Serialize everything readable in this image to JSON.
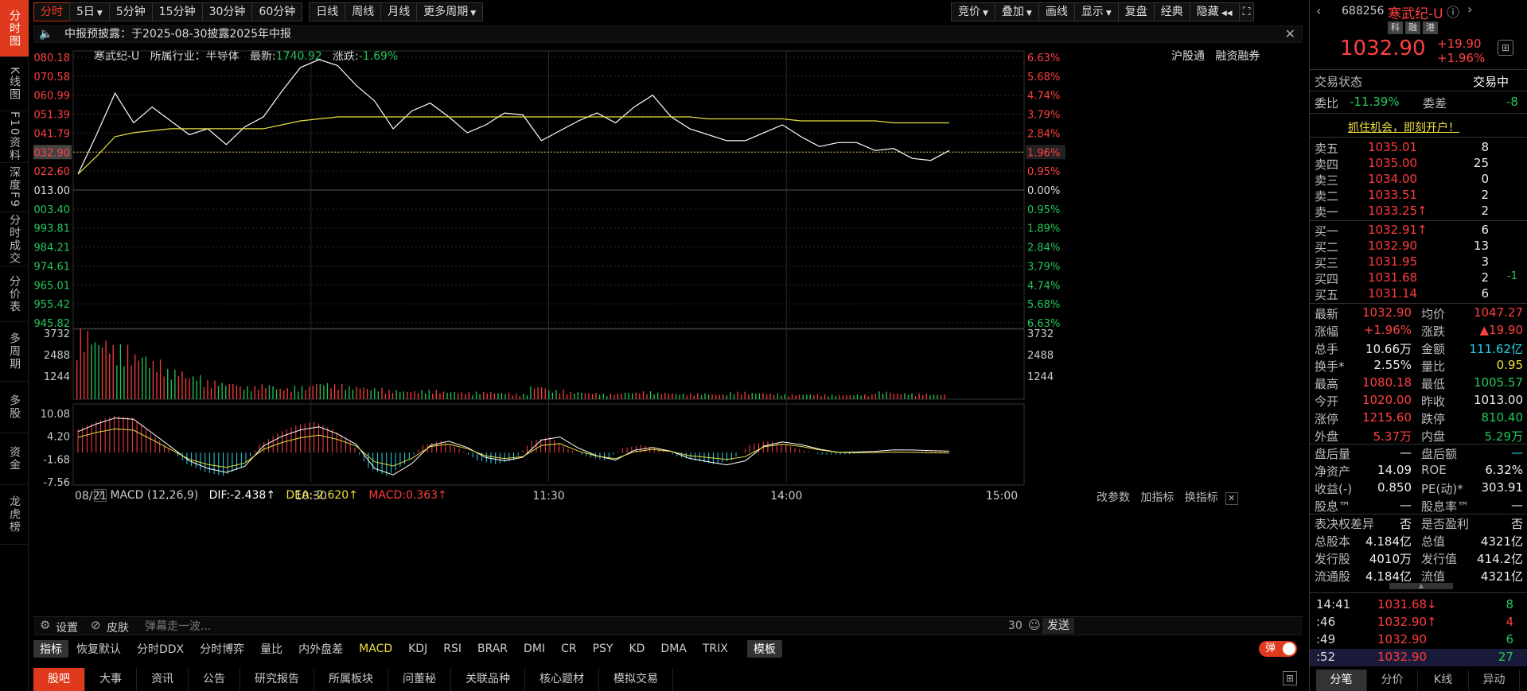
{
  "leftnav": {
    "items": [
      "分时图",
      "K线图",
      "F10资料",
      "深度F9",
      "分时成交",
      "分价表",
      "多周期",
      "多股",
      "资金",
      "龙虎榜"
    ]
  },
  "toolbar": {
    "periods": [
      "分时",
      "5日",
      "5分钟",
      "15分钟",
      "30分钟",
      "60分钟",
      "日线",
      "周线",
      "月线",
      "更多周期"
    ],
    "right": [
      "竞价",
      "叠加",
      "画线",
      "显示",
      "复盘",
      "经典",
      "隐藏"
    ]
  },
  "notice": {
    "text": "中报预披露：于2025-08-30披露2025年中报"
  },
  "info": {
    "name": "寒武纪-U",
    "industry_label": "所属行业：",
    "industry": "半导体",
    "latest_label": "最新:",
    "latest": "1740.92",
    "change_label": "涨跌:",
    "change": "-1.69%",
    "right_links": [
      "沪股通",
      "融资融券"
    ]
  },
  "price_axis": {
    "left": [
      "1080.18",
      "1070.58",
      "1060.99",
      "1051.39",
      "1041.79",
      "1032.90",
      "1022.60",
      "1013.00",
      "1003.40",
      "993.81",
      "984.21",
      "974.61",
      "965.01",
      "955.42",
      "945.82"
    ],
    "right": [
      "6.63%",
      "5.68%",
      "4.74%",
      "3.79%",
      "2.84%",
      "1.96%",
      "0.95%",
      "0.00%",
      "0.95%",
      "1.89%",
      "2.84%",
      "3.79%",
      "4.74%",
      "5.68%",
      "6.63%"
    ]
  },
  "volume_axis": {
    "left": [
      "3732",
      "2488",
      "1244"
    ],
    "right": [
      "3732",
      "2488",
      "1244"
    ]
  },
  "macd_axis": [
    "10.08",
    "4.20",
    "-1.68",
    "-7.56"
  ],
  "time_axis": [
    "08/21",
    "10:30",
    "11:30",
    "14:00",
    "15:00"
  ],
  "macd": {
    "name": "MACD (12,26,9)",
    "dif": "DIF:-2.438↑",
    "dea": "DEA:-2.620↑",
    "macd": "MACD:0.363↑",
    "tools": [
      "改参数",
      "加指标",
      "换指标"
    ]
  },
  "danmu": {
    "settings": "设置",
    "skin": "皮肤",
    "placeholder": "弹幕走一波...",
    "count": "30",
    "send": "发送"
  },
  "indicators": [
    "指标",
    "恢复默认",
    "分时DDX",
    "分时博弈",
    "量比",
    "内外盘差",
    "MACD",
    "KDJ",
    "RSI",
    "BRAR",
    "DMI",
    "CR",
    "PSY",
    "KD",
    "DMA",
    "TRIX",
    "模板"
  ],
  "danmu_toggle": "弹",
  "bottom_tabs": [
    "股吧",
    "大事",
    "资讯",
    "公告",
    "研究报告",
    "所属板块",
    "问董秘",
    "关联品种",
    "核心题材",
    "模拟交易"
  ],
  "quote": {
    "code": "688256",
    "name": "寒武纪-U",
    "tags": [
      "科",
      "融",
      "港"
    ],
    "price": "1032.90",
    "change": "+19.90",
    "change_pct": "+1.96%",
    "status_label": "交易状态",
    "status": "交易中",
    "weibi_label": "委比",
    "weibi": "-11.39%",
    "weicha_label": "委差",
    "weicha": "-8",
    "open_account": "抓住机会，即刻开户！"
  },
  "orderbook": {
    "asks": [
      {
        "label": "卖五",
        "price": "1035.01",
        "vol": "8",
        "mark": ""
      },
      {
        "label": "卖四",
        "price": "1035.00",
        "vol": "25",
        "mark": ""
      },
      {
        "label": "卖三",
        "price": "1034.00",
        "vol": "0",
        "mark": ""
      },
      {
        "label": "卖二",
        "price": "1033.51",
        "vol": "2",
        "mark": ""
      },
      {
        "label": "卖一",
        "price": "1033.25↑",
        "vol": "2",
        "mark": ""
      }
    ],
    "bids": [
      {
        "label": "买一",
        "price": "1032.91↑",
        "vol": "6",
        "mark": ""
      },
      {
        "label": "买二",
        "price": "1032.90",
        "vol": "13",
        "mark": ""
      },
      {
        "label": "买三",
        "price": "1031.95",
        "vol": "3",
        "mark": ""
      },
      {
        "label": "买四",
        "price": "1031.68",
        "vol": "2",
        "mark": "-1"
      },
      {
        "label": "买五",
        "price": "1031.14",
        "vol": "6",
        "mark": ""
      }
    ]
  },
  "stats": [
    [
      "最新",
      "1032.90",
      "均价",
      "1047.27"
    ],
    [
      "涨幅",
      "+1.96%",
      "涨跌",
      "▲19.90"
    ],
    [
      "总手",
      "10.66万",
      "金额",
      "111.62亿"
    ],
    [
      "换手*",
      "2.55%",
      "量比",
      "0.95"
    ],
    [
      "最高",
      "1080.18",
      "最低",
      "1005.57"
    ],
    [
      "今开",
      "1020.00",
      "昨收",
      "1013.00"
    ],
    [
      "涨停",
      "1215.60",
      "跌停",
      "810.40"
    ],
    [
      "外盘",
      "5.37万",
      "内盘",
      "5.29万"
    ],
    [
      "盘后量",
      "—",
      "盘后额",
      "—"
    ],
    [
      "净资产",
      "14.09",
      "ROE",
      "6.32%"
    ],
    [
      "收益(-)",
      "0.850",
      "PE(动)*",
      "303.91"
    ],
    [
      "股息™",
      "—",
      "股息率™",
      "—"
    ],
    [
      "表决权差异",
      "否",
      "是否盈利",
      "否"
    ],
    [
      "总股本",
      "4.184亿",
      "总值",
      "4321亿"
    ],
    [
      "发行股",
      "4010万",
      "发行值",
      "414.2亿"
    ],
    [
      "流通股",
      "4.184亿",
      "流值",
      "4321亿"
    ]
  ],
  "ticks": [
    {
      "time": "14:41",
      "price": "1031.68↓",
      "vol": "8"
    },
    {
      "time": ":46",
      "price": "1032.90↑",
      "vol": "4"
    },
    {
      "time": ":49",
      "price": "1032.90",
      "vol": "6"
    },
    {
      "time": ":52",
      "price": "1032.90",
      "vol": "27"
    }
  ],
  "right_tabs": [
    "分笔",
    "分价",
    "K线",
    "异动"
  ],
  "chart_data": {
    "type": "line",
    "prev_close": 1013.0,
    "ylim": [
      945.82,
      1080.18
    ],
    "x": [
      "09:30",
      "09:35",
      "09:40",
      "09:45",
      "09:50",
      "09:55",
      "10:00",
      "10:05",
      "10:10",
      "10:15",
      "10:20",
      "10:25",
      "10:30",
      "10:35",
      "10:40",
      "10:45",
      "10:50",
      "10:55",
      "11:00",
      "11:05",
      "11:10",
      "11:15",
      "11:20",
      "11:25",
      "11:30",
      "13:05",
      "13:10",
      "13:15",
      "13:20",
      "13:25",
      "13:30",
      "13:35",
      "13:40",
      "13:45",
      "13:50",
      "13:55",
      "14:00",
      "14:05",
      "14:10",
      "14:15",
      "14:20",
      "14:25",
      "14:30",
      "14:35",
      "14:40",
      "14:45",
      "14:50",
      "14:55"
    ],
    "series": [
      {
        "name": "price",
        "values": [
          1021,
          1041,
          1062,
          1047,
          1055,
          1048,
          1041,
          1044,
          1036,
          1045,
          1050,
          1063,
          1075,
          1079,
          1076,
          1066,
          1058,
          1044,
          1053,
          1057,
          1050,
          1042,
          1046,
          1052,
          1051,
          1038,
          1043,
          1048,
          1052,
          1047,
          1055,
          1061,
          1050,
          1044,
          1041,
          1038,
          1038,
          1042,
          1046,
          1040,
          1035,
          1037,
          1037,
          1033,
          1034,
          1029,
          1028,
          1033
        ]
      },
      {
        "name": "avg",
        "values": [
          1021,
          1030,
          1040,
          1042,
          1043,
          1044,
          1044,
          1044,
          1044,
          1044,
          1044,
          1046,
          1048,
          1049,
          1050,
          1050,
          1050,
          1050,
          1050,
          1050,
          1050,
          1050,
          1050,
          1050,
          1050,
          1050,
          1050,
          1050,
          1050,
          1050,
          1050,
          1050,
          1050,
          1050,
          1049,
          1049,
          1049,
          1049,
          1049,
          1048,
          1048,
          1048,
          1048,
          1048,
          1047,
          1047,
          1047,
          1047
        ]
      }
    ],
    "volume": [
      3732,
      3300,
      2900,
      2500,
      2100,
      1600,
      1300,
      1000,
      900,
      700,
      800,
      600,
      700,
      900,
      800,
      700,
      600,
      500,
      450,
      500,
      420,
      380,
      400,
      350,
      300,
      700,
      500,
      400,
      350,
      300,
      380,
      420,
      350,
      300,
      320,
      280,
      400,
      350,
      300,
      260,
      280,
      250,
      240,
      260,
      420,
      330,
      300,
      260
    ],
    "macd_ylim": [
      -7.56,
      10.08
    ],
    "macd_hist": [
      6,
      8,
      9.5,
      9,
      5,
      1,
      -3,
      -5,
      -6,
      -4,
      2,
      5,
      7,
      8,
      6,
      3,
      -4,
      -6,
      -3,
      2,
      3,
      1,
      -2,
      -3,
      -2,
      3,
      4,
      1,
      -1,
      -2,
      1,
      2,
      1,
      -1,
      -2,
      -3,
      -2,
      2,
      3,
      2,
      0.5,
      -0.5,
      -0.5,
      -0.3,
      0.2,
      0.3,
      0.3,
      0.36
    ]
  }
}
